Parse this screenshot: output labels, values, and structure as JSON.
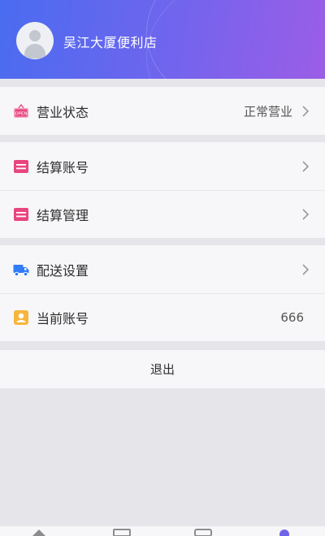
{
  "header": {
    "store_name": "吴江大厦便利店"
  },
  "menu": {
    "business_status": {
      "label": "营业状态",
      "value": "正常营业",
      "icon": "open-sign-icon"
    },
    "settlement_account": {
      "label": "结算账号",
      "icon": "card-icon"
    },
    "settlement_management": {
      "label": "结算管理",
      "icon": "card-icon"
    },
    "delivery_settings": {
      "label": "配送设置",
      "icon": "truck-icon"
    },
    "current_account": {
      "label": "当前账号",
      "value": "666",
      "icon": "account-badge-icon"
    }
  },
  "logout": {
    "label": "退出"
  },
  "tabbar": {
    "icons": [
      "home-icon",
      "orders-icon",
      "goods-icon",
      "profile-icon"
    ]
  },
  "colors": {
    "header_gradient_start": "#4a6cf0",
    "header_gradient_end": "#9b5ee6",
    "pink_icon": "#e8457e",
    "blue_icon": "#2f7cf6",
    "orange_icon": "#f6b53d",
    "background": "#e6e5ea"
  }
}
